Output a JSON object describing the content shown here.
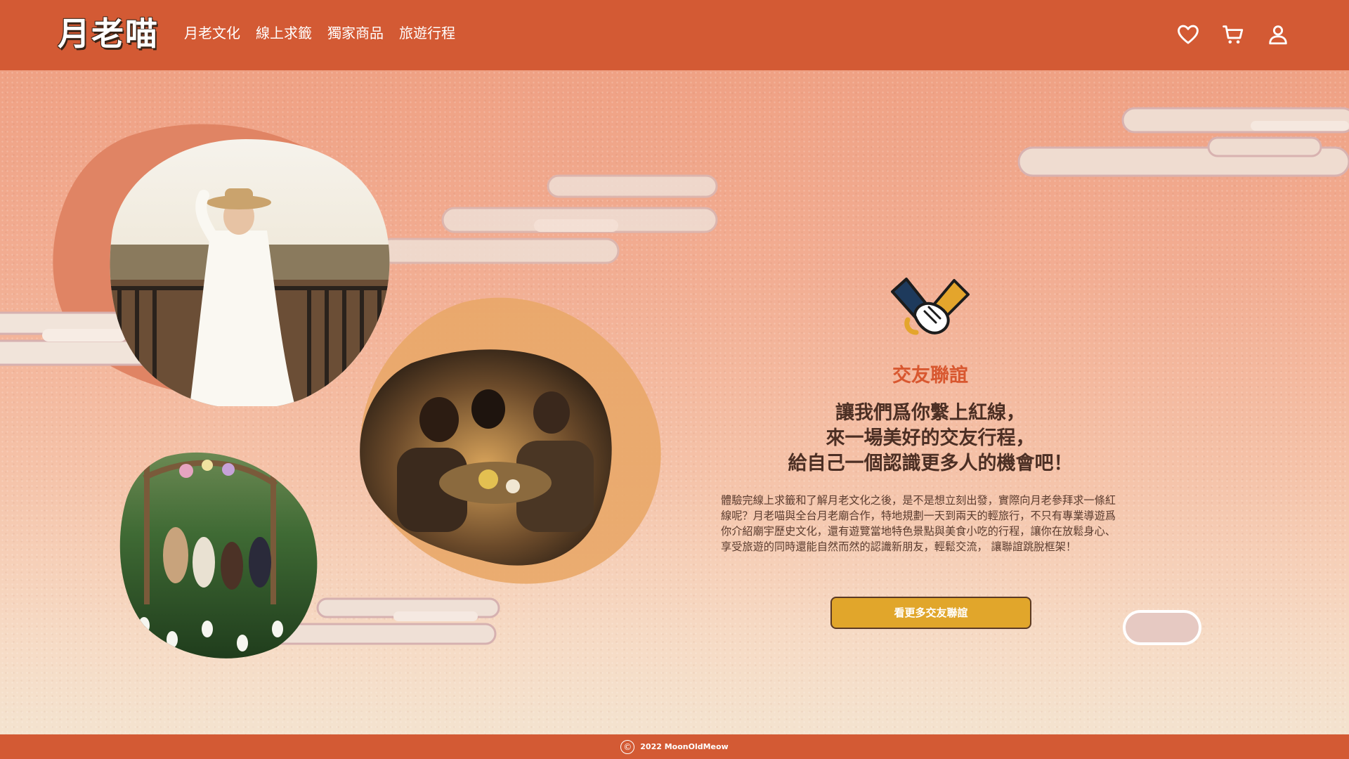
{
  "header": {
    "logo": "月老喵",
    "nav": [
      "月老文化",
      "線上求籤",
      "獨家商品",
      "旅遊行程"
    ],
    "icons": [
      "heart-icon",
      "cart-icon",
      "user-icon"
    ]
  },
  "feature": {
    "icon": "handshake-icon",
    "label": "交友聯誼",
    "headline": [
      "讓我們爲你繫上紅線，",
      "來一場美好的交友行程，",
      "給自己一個認識更多人的機會吧！"
    ],
    "body": [
      "體驗完線上求籤和了解月老文化之後，是不是想立刻出發，實際向月老參拜求一條紅",
      "線呢？月老喵與全台月老廟合作，特地規劃一天到兩天的輕旅行，不只有專業導遊爲",
      "你介紹廟宇歷史文化，還有遊覽當地特色景點與美食小吃的行程，讓你在放鬆身心、",
      "享受旅遊的同時還能自然而然的認識新朋友，輕鬆交流， 讓聯誼跳脫框架！"
    ],
    "cta": "看更多交友聯誼"
  },
  "carousel": {
    "total": 2,
    "active": 1
  },
  "footer": {
    "copyright_symbol": "©",
    "text": "2022 MoonOldMeow"
  },
  "colors": {
    "brand": "#d35a34",
    "accent": "#e1a62b",
    "headline": "#4c2f24",
    "label": "#d8572f"
  }
}
